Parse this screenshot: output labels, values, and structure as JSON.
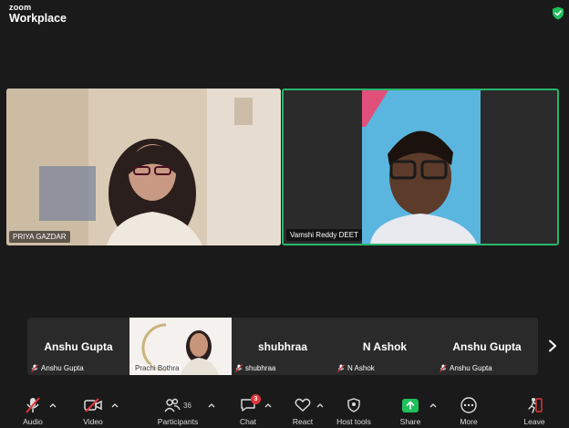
{
  "app": {
    "brand_top": "zoom",
    "brand_bottom": "Workplace"
  },
  "icons": {
    "security": "shield-check-icon",
    "more_participants": "chevron-right-icon"
  },
  "video_tiles": [
    {
      "name": "PRIYA GAZDAR"
    },
    {
      "name": "Vamshi Reddy DEET",
      "active_speaker": true
    }
  ],
  "participant_strip": [
    {
      "display": "Anshu Gupta",
      "name": "Anshu Gupta",
      "muted": true
    },
    {
      "display": "",
      "name": "Prachi Bothra",
      "muted": false,
      "video": true
    },
    {
      "display": "shubhraa",
      "name": "shubhraa",
      "muted": true
    },
    {
      "display": "N Ashok",
      "name": "N Ashok",
      "muted": true
    },
    {
      "display": "Anshu Gupta",
      "name": "Anshu Gupta",
      "muted": true
    }
  ],
  "toolbar": {
    "audio": "Audio",
    "video": "Video",
    "participants": "Participants",
    "participants_count": "36",
    "chat": "Chat",
    "chat_badge": "3",
    "react": "React",
    "host_tools": "Host tools",
    "share": "Share",
    "more": "More",
    "leave": "Leave"
  },
  "colors": {
    "speaker_border": "#28b56c",
    "share_green": "#1fbf5a",
    "leave_red": "#e0363b",
    "muted_red": "#e0363b"
  }
}
